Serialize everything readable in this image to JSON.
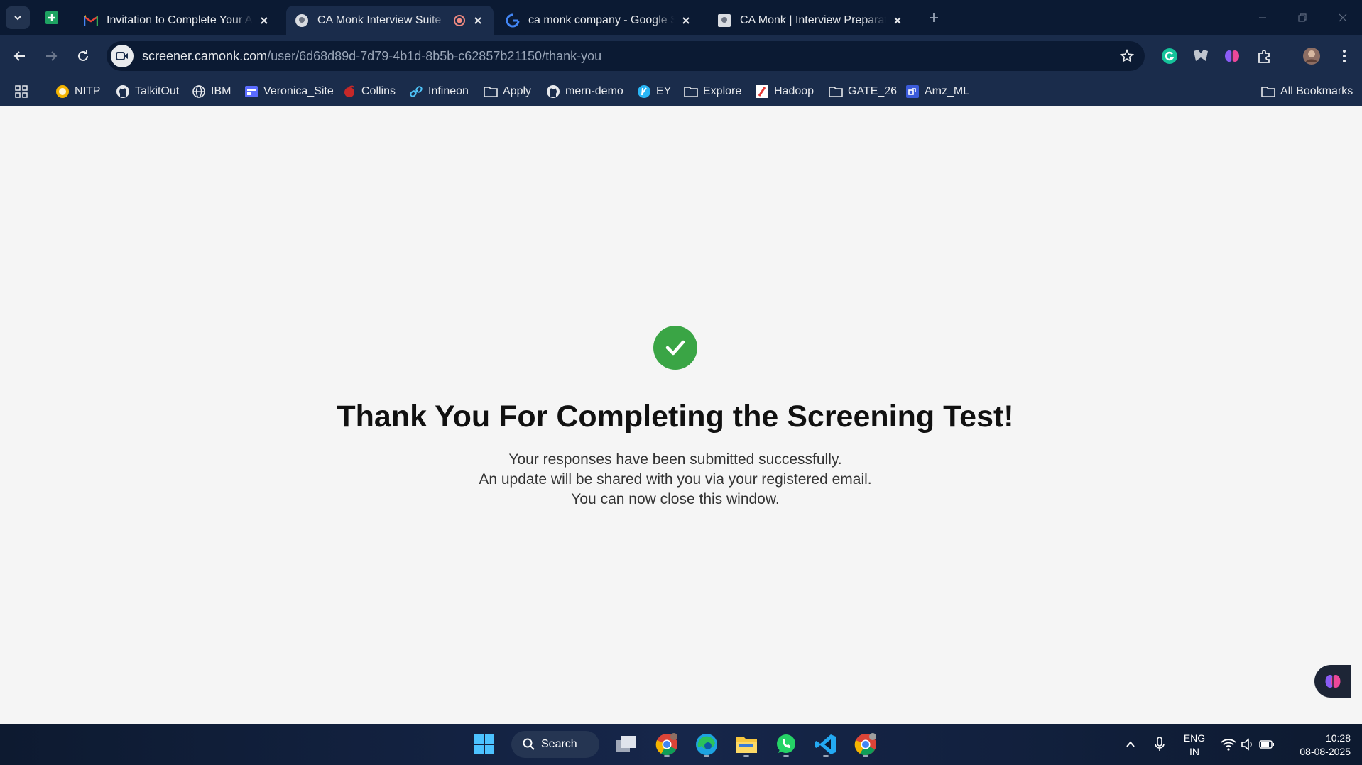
{
  "browser": {
    "tabs": [
      {
        "title": "Invitation to Complete Your AI Assessment",
        "favicon": "gmail-icon"
      },
      {
        "title": "CA Monk Interview Suite",
        "favicon": "camonk-icon",
        "recording": true,
        "active": true
      },
      {
        "title": "ca monk company - Google Search",
        "favicon": "google-icon"
      },
      {
        "title": "CA Monk | Interview Preparation",
        "favicon": "camonk-icon"
      }
    ],
    "url_host": "screener.camonk.com",
    "url_path": "/user/6d68d89d-7d79-4b1d-8b5b-c62857b21150/thank-you",
    "bookmarks": [
      {
        "label": "NITP",
        "icon": "nitp-icon"
      },
      {
        "label": "TalkitOut",
        "icon": "github-icon"
      },
      {
        "label": "IBM",
        "icon": "globe-icon"
      },
      {
        "label": "Veronica_Site",
        "icon": "site-icon"
      },
      {
        "label": "Collins",
        "icon": "collins-icon"
      },
      {
        "label": "Infineon",
        "icon": "link-icon"
      },
      {
        "label": "Apply",
        "icon": "folder-icon"
      },
      {
        "label": "mern-demo",
        "icon": "github-icon"
      },
      {
        "label": "EY",
        "icon": "ey-icon"
      },
      {
        "label": "Explore",
        "icon": "folder-icon"
      },
      {
        "label": "Hadoop",
        "icon": "hadoop-icon"
      },
      {
        "label": "GATE_26",
        "icon": "folder-icon"
      },
      {
        "label": "Amz_ML",
        "icon": "app-icon"
      }
    ],
    "all_bookmarks_label": "All Bookmarks"
  },
  "page": {
    "heading": "Thank You For Completing the Screening Test!",
    "line1": "Your responses have been submitted successfully.",
    "line2": "An update will be shared with you via your registered email.",
    "line3": "You can now close this window."
  },
  "taskbar": {
    "search_label": "Search",
    "language_line1": "ENG",
    "language_line2": "IN",
    "time": "10:28",
    "date": "08-08-2025"
  },
  "colors": {
    "success": "#3aa545",
    "chrome_dark": "#0b1a33",
    "chrome_toolbar": "#1a2c4b"
  }
}
